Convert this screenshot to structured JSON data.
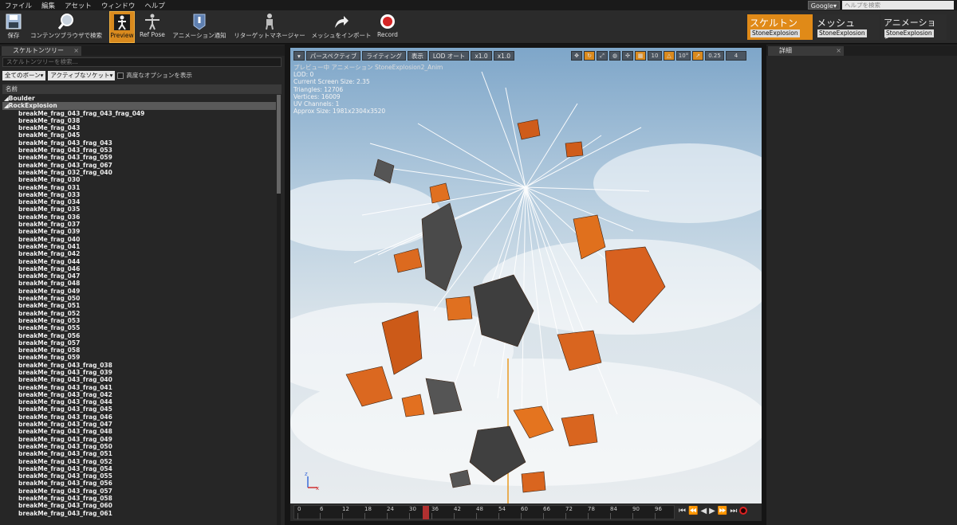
{
  "menubar": {
    "items": [
      "ファイル",
      "編集",
      "アセット",
      "ウィンドウ",
      "ヘルプ"
    ],
    "google": "Google▾",
    "help_placeholder": "ヘルプを検索"
  },
  "toolbar": {
    "buttons": [
      "保存",
      "コンテンツブラウザで検索",
      "Preview",
      "Ref Pose",
      "アニメーション通知",
      "リターゲットマネージャー",
      "メッシュをインポート",
      "Record"
    ]
  },
  "modes": [
    {
      "label": "スケルトン",
      "asset": "StoneExplosion"
    },
    {
      "label": "メッシュ",
      "asset": "StoneExplosion"
    },
    {
      "label": "アニメーション",
      "asset": "StoneExplosion"
    }
  ],
  "skeleton_tree": {
    "tab": "スケルトンツリー",
    "search_placeholder": "スケルトンツリーを検索...",
    "bones_filter": "全てのボーン▾",
    "socket_filter": "アクティブなソケット▾",
    "advanced_label": "高度なオプションを表示",
    "column_header": "名前",
    "rows": [
      "◢Boulder",
      "◢RockExplosion",
      "breakMe_frag_043_frag_043_frag_049",
      "breakMe_frag_038",
      "breakMe_frag_043",
      "breakMe_frag_045",
      "breakMe_frag_043_frag_043",
      "breakMe_frag_043_frag_053",
      "breakMe_frag_043_frag_059",
      "breakMe_frag_043_frag_067",
      "breakMe_frag_032_frag_040",
      "breakMe_frag_030",
      "breakMe_frag_031",
      "breakMe_frag_033",
      "breakMe_frag_034",
      "breakMe_frag_035",
      "breakMe_frag_036",
      "breakMe_frag_037",
      "breakMe_frag_039",
      "breakMe_frag_040",
      "breakMe_frag_041",
      "breakMe_frag_042",
      "breakMe_frag_044",
      "breakMe_frag_046",
      "breakMe_frag_047",
      "breakMe_frag_048",
      "breakMe_frag_049",
      "breakMe_frag_050",
      "breakMe_frag_051",
      "breakMe_frag_052",
      "breakMe_frag_053",
      "breakMe_frag_055",
      "breakMe_frag_056",
      "breakMe_frag_057",
      "breakMe_frag_058",
      "breakMe_frag_059",
      "breakMe_frag_043_frag_038",
      "breakMe_frag_043_frag_039",
      "breakMe_frag_043_frag_040",
      "breakMe_frag_043_frag_041",
      "breakMe_frag_043_frag_042",
      "breakMe_frag_043_frag_044",
      "breakMe_frag_043_frag_045",
      "breakMe_frag_043_frag_046",
      "breakMe_frag_043_frag_047",
      "breakMe_frag_043_frag_048",
      "breakMe_frag_043_frag_049",
      "breakMe_frag_043_frag_050",
      "breakMe_frag_043_frag_051",
      "breakMe_frag_043_frag_052",
      "breakMe_frag_043_frag_054",
      "breakMe_frag_043_frag_055",
      "breakMe_frag_043_frag_056",
      "breakMe_frag_043_frag_057",
      "breakMe_frag_043_frag_058",
      "breakMe_frag_043_frag_060",
      "breakMe_frag_043_frag_061"
    ],
    "selected_index": 1
  },
  "viewport": {
    "perspective": "パースペクティブ",
    "lighting": "ライティング",
    "show": "表示",
    "lod": "LOD オート",
    "speed1": "x1.0",
    "speed2": "x1.0",
    "grid": "10",
    "angle": "10°",
    "scale": "0.25",
    "cam": "4",
    "preview_label": "プレビュー中 アニメーション StoneExplosion2_Anim",
    "stats": [
      "LOD: 0",
      "Current Screen Size: 2.35",
      "Triangles: 12706",
      "Vertices: 16009",
      "UV Channels: 1",
      "Approx Size: 1981x2304x3520"
    ]
  },
  "timeline": {
    "ticks": [
      "0",
      "6",
      "12",
      "18",
      "24",
      "30",
      "36",
      "42",
      "48",
      "54",
      "60",
      "66",
      "72",
      "78",
      "84",
      "90",
      "96"
    ],
    "current_frame": 33
  },
  "details": {
    "tab": "詳細"
  },
  "colors": {
    "accent": "#e08a18",
    "bg": "#262626",
    "record": "#dd2222"
  }
}
